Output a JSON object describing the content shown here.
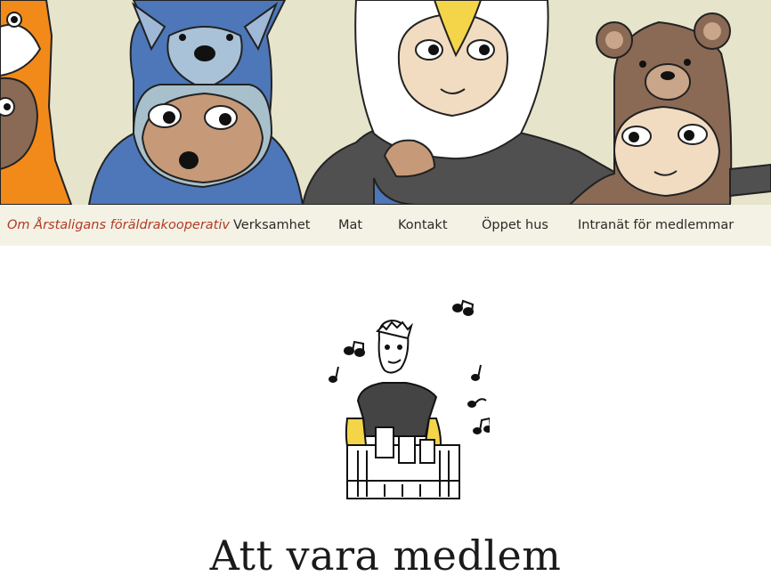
{
  "header": {
    "banner_name": "children-in-animal-costumes-banner",
    "colors": {
      "background": "#e7e4cc",
      "fox": "#f28a1a",
      "wolf": "#4d77b8",
      "eagle": "#ffffff",
      "bear": "#8a6a55"
    }
  },
  "nav": {
    "home": "Om Årstaligans föräldrakooperativ",
    "items": [
      {
        "label": "Verksamhet"
      },
      {
        "label": "Mat"
      },
      {
        "label": "Kontakt"
      },
      {
        "label": "Öppet hus"
      },
      {
        "label": "Intranät för medlemmar"
      }
    ],
    "colors": {
      "background": "#f3f2e4",
      "home": "#b23a25",
      "link": "#2a2a2a"
    }
  },
  "main": {
    "illustration": "person-washing-dishes-with-music-notes",
    "title": "Att vara medlem"
  }
}
